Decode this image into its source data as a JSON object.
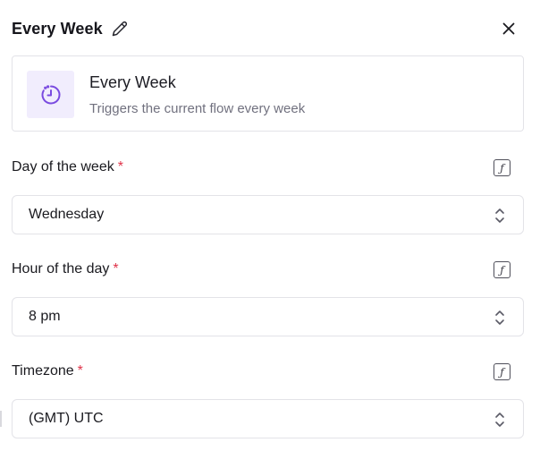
{
  "header": {
    "title": "Every Week"
  },
  "trigger": {
    "name": "Every Week",
    "description": "Triggers the current flow every week"
  },
  "fields": [
    {
      "label": "Day of the week",
      "required_mark": "*",
      "value": "Wednesday"
    },
    {
      "label": "Hour of the day",
      "required_mark": "*",
      "value": "8 pm"
    },
    {
      "label": "Timezone",
      "required_mark": "*",
      "value": "(GMT) UTC"
    }
  ],
  "colors": {
    "accent": "#7a4be0",
    "accent_bg": "#f1edfd",
    "required": "#e0344a",
    "border": "#e3e3e8"
  },
  "icons": {
    "edit": "pencil-icon",
    "close": "close-icon",
    "trigger": "clock-icon",
    "formula": "formula-icon",
    "select": "chevron-up-down-icon"
  }
}
